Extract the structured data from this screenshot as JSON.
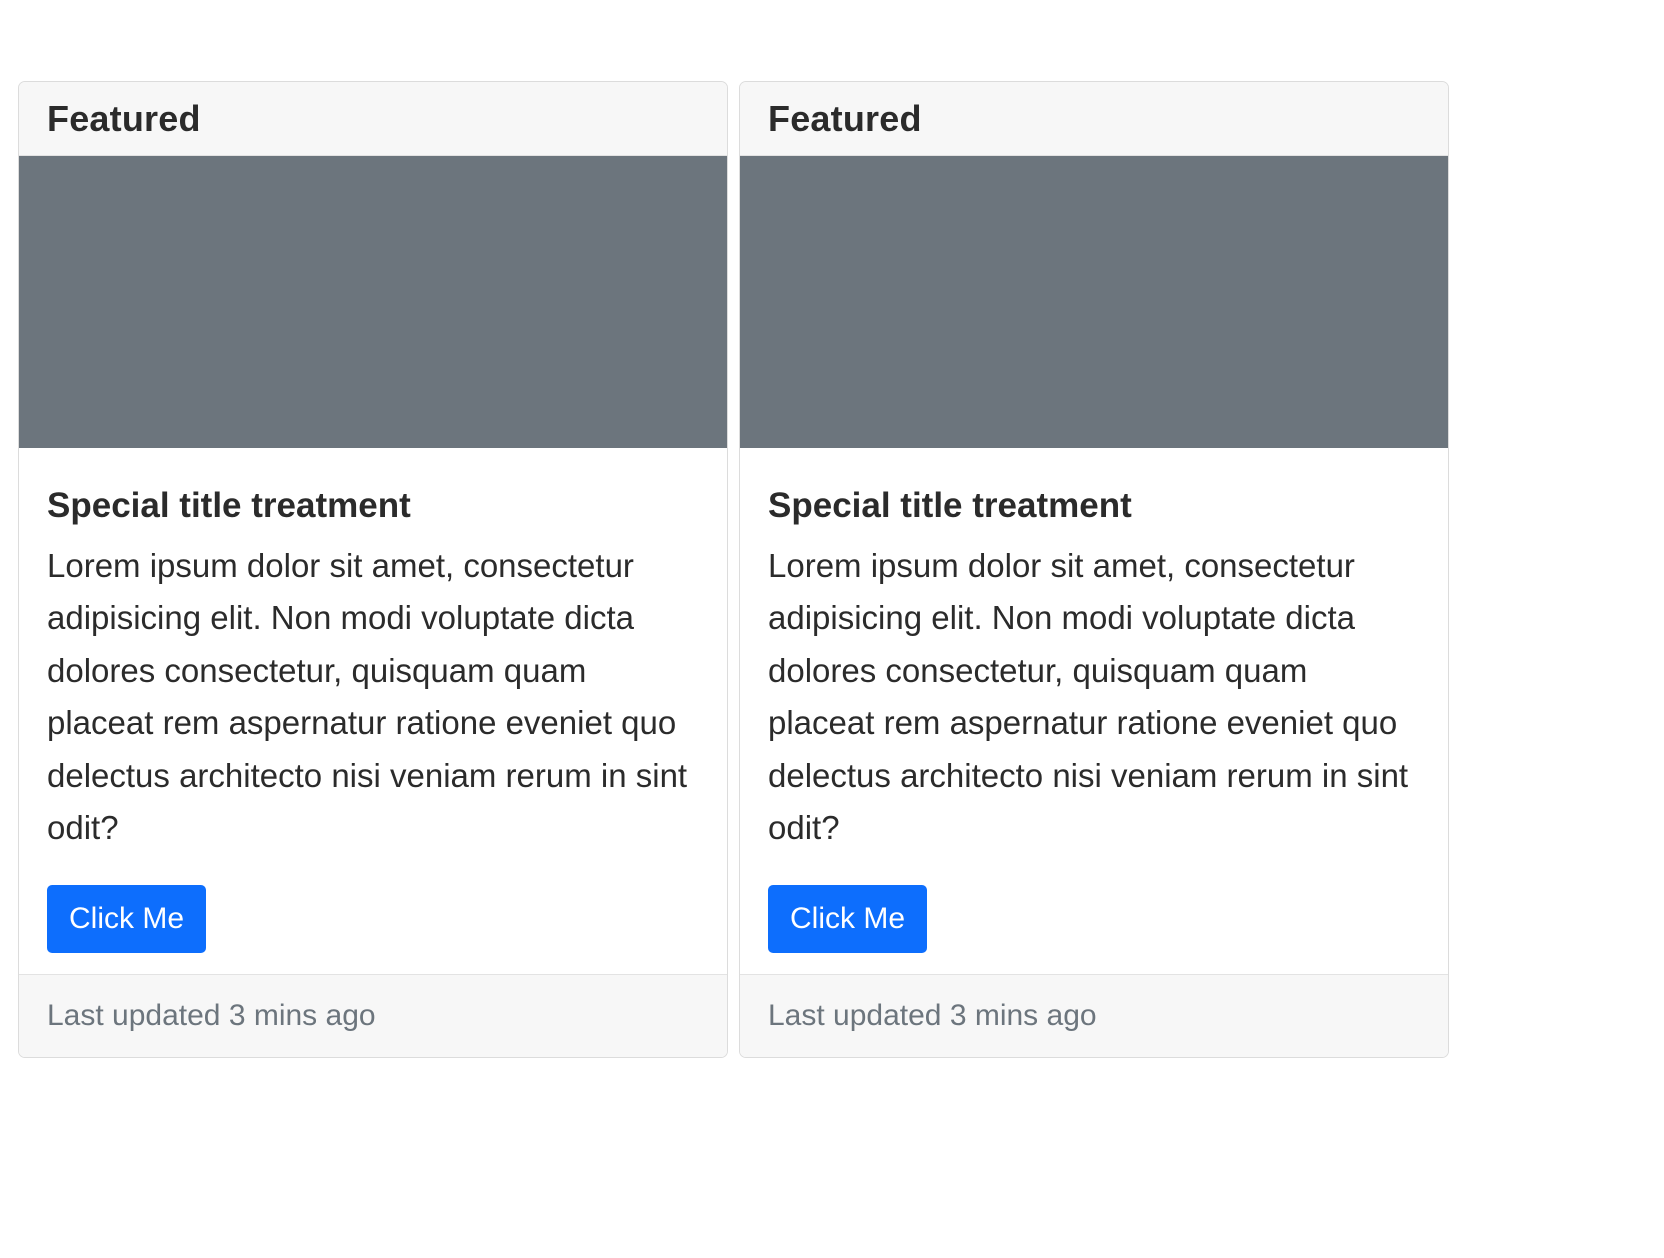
{
  "cards": [
    {
      "header": "Featured",
      "title": "Special title treatment",
      "text": "Lorem ipsum dolor sit amet, consectetur adipisicing elit. Non modi voluptate dicta dolores consectetur, quisquam quam placeat rem aspernatur ratione eveniet quo delectus architecto nisi veniam rerum in sint odit?",
      "button_label": "Click Me",
      "footer": "Last updated 3 mins ago"
    },
    {
      "header": "Featured",
      "title": "Special title treatment",
      "text": "Lorem ipsum dolor sit amet, consectetur adipisicing elit. Non modi voluptate dicta dolores consectetur, quisquam quam placeat rem aspernatur ratione eveniet quo delectus architecto nisi veniam rerum in sint odit?",
      "button_label": "Click Me",
      "footer": "Last updated 3 mins ago"
    }
  ],
  "colors": {
    "image_placeholder": "#6c757d",
    "button_primary": "#0d6efd",
    "muted_text": "#6c757d",
    "header_footer_bg": "#f7f7f7"
  }
}
